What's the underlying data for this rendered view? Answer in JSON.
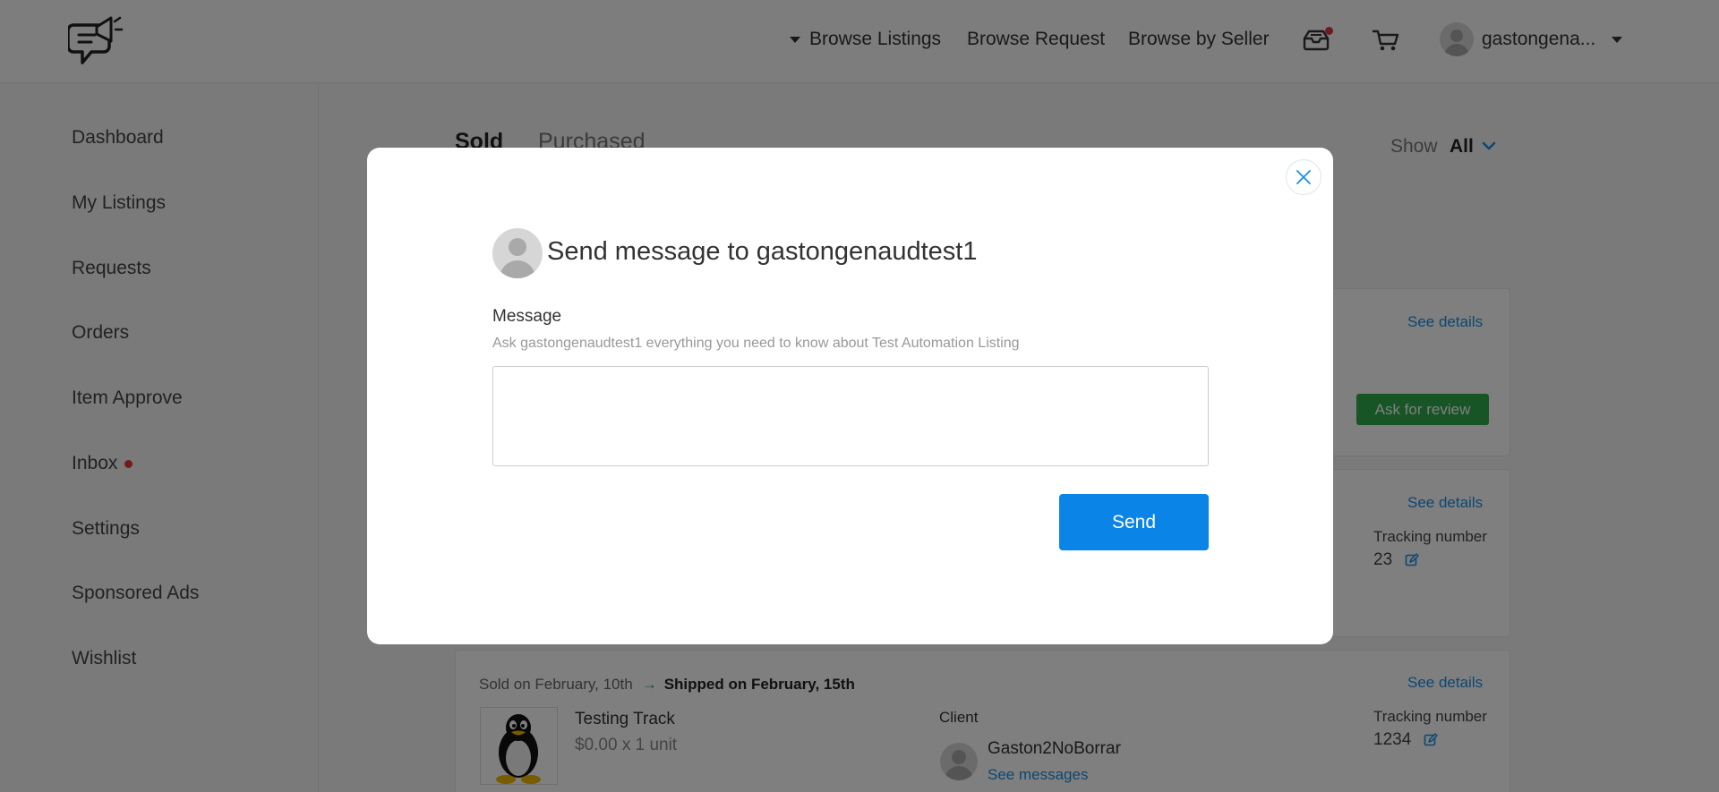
{
  "header": {
    "nav": {
      "browse_listings": "Browse Listings",
      "browse_request": "Browse Request",
      "browse_by_seller": "Browse by Seller"
    },
    "user_name": "gastongena...",
    "icons": [
      "logo-icon",
      "caret-down-icon",
      "inbox-icon",
      "notification-dot",
      "cart-icon",
      "avatar-icon"
    ]
  },
  "sidebar": {
    "items": [
      {
        "label": "Dashboard"
      },
      {
        "label": "My Listings"
      },
      {
        "label": "Requests"
      },
      {
        "label": "Orders"
      },
      {
        "label": "Item Approve"
      },
      {
        "label": "Inbox"
      },
      {
        "label": "Settings"
      },
      {
        "label": "Sponsored Ads"
      },
      {
        "label": "Wishlist"
      }
    ]
  },
  "main": {
    "tabs": [
      {
        "label": "Sold"
      },
      {
        "label": "Purchased"
      }
    ],
    "show_label": "Show",
    "show_value": "All",
    "cards": [
      {
        "see_details": "See details",
        "ask_review": "Ask for review"
      },
      {
        "see_details": "See details",
        "tracking_label": "Tracking number",
        "tracking_value": "23"
      },
      {
        "see_details": "See details",
        "sold_on": "Sold on February, 10th",
        "shipped_on": "Shipped on February, 15th",
        "product_name": "Testing Track",
        "product_price": "$0.00 x 1 unit",
        "client_label": "Client",
        "client_name": "Gaston2NoBorrar",
        "see_messages": "See messages",
        "tracking_label": "Tracking number",
        "tracking_value": "1234"
      }
    ]
  },
  "modal": {
    "title": "Send message to gastongenaudtest1",
    "message_label": "Message",
    "message_hint": "Ask gastongenaudtest1 everything you need to know about Test Automation Listing",
    "message_value": "",
    "send_label": "Send"
  },
  "colors": {
    "primary_blue": "#0a84e6",
    "link_blue": "#1a8fe3",
    "green": "#2eaa4f",
    "alert_red": "#e0393e"
  }
}
